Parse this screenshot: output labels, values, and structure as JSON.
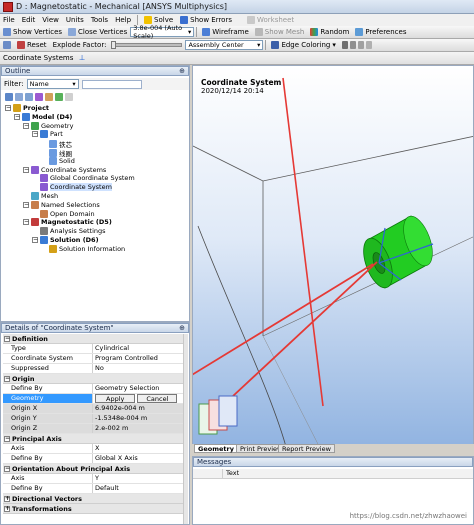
{
  "window": {
    "title": "D : Magnetostatic - Mechanical [ANSYS Multiphysics]"
  },
  "menubar": {
    "items": [
      "File",
      "Edit",
      "View",
      "Units",
      "Tools",
      "Help"
    ],
    "solve_label": "Solve",
    "show_errors_label": "Show Errors",
    "worksheet_label": "Worksheet"
  },
  "toolbar2": {
    "show_vertices_label": "Show Vertices",
    "close_vertices_label": "Close Vertices",
    "autoscale_value": "3.8e-004 (Auto Scale)",
    "wireframe_label": "Wireframe",
    "show_mesh_label": "Show Mesh",
    "random_label": "Random",
    "preferences_label": "Preferences"
  },
  "toolbar3": {
    "reset_label": "Reset",
    "explode_label": "Explode Factor:",
    "assembly_center_value": "Assembly Center",
    "edge_coloring_label": "Edge Coloring"
  },
  "context_toolbar": {
    "label": "Coordinate Systems"
  },
  "outline": {
    "title": "Outline",
    "pin": "⊕",
    "filter_label": "Filter:",
    "filter_value": "Name",
    "tree": [
      {
        "label": "Project",
        "level": 0,
        "bold": true
      },
      {
        "label": "Model (D4)",
        "level": 1,
        "bold": true
      },
      {
        "label": "Geometry",
        "level": 2
      },
      {
        "label": "Part",
        "level": 3
      },
      {
        "label": "铁芯",
        "level": 4
      },
      {
        "label": "线圈",
        "level": 4
      },
      {
        "label": "Solid",
        "level": 4
      },
      {
        "label": "Coordinate Systems",
        "level": 2
      },
      {
        "label": "Global Coordinate System",
        "level": 3
      },
      {
        "label": "Coordinate System",
        "level": 3
      },
      {
        "label": "Mesh",
        "level": 2
      },
      {
        "label": "Named Selections",
        "level": 2
      },
      {
        "label": "Open Domain",
        "level": 3
      },
      {
        "label": "Magnetostatic (D5)",
        "level": 2,
        "bold": true
      },
      {
        "label": "Analysis Settings",
        "level": 3
      },
      {
        "label": "Solution (D6)",
        "level": 3,
        "bold": true
      },
      {
        "label": "Solution Information",
        "level": 4
      }
    ]
  },
  "details": {
    "title": "Details of \"Coordinate System\"",
    "pin": "⊕",
    "sections": [
      {
        "name": "Definition",
        "rows": [
          {
            "key": "Type",
            "value": "Cylindrical"
          },
          {
            "key": "Coordinate System",
            "value": "Program Controlled"
          },
          {
            "key": "Suppressed",
            "value": "No"
          }
        ]
      },
      {
        "name": "Origin",
        "rows": [
          {
            "key": "Define By",
            "value": "Geometry Selection"
          },
          {
            "key": "Geometry",
            "value": ""
          },
          {
            "key": "Origin X",
            "value": "6.9402e-004 m"
          },
          {
            "key": "Origin Y",
            "value": "-1.5348e-004 m"
          },
          {
            "key": "Origin Z",
            "value": "2.e-002 m"
          }
        ]
      },
      {
        "name": "Principal Axis",
        "rows": [
          {
            "key": "Axis",
            "value": "X"
          },
          {
            "key": "Define By",
            "value": "Global X Axis"
          }
        ]
      },
      {
        "name": "Orientation About Principal Axis",
        "rows": [
          {
            "key": "Axis",
            "value": "Y"
          },
          {
            "key": "Define By",
            "value": "Default"
          }
        ]
      },
      {
        "name": "Directional Vectors",
        "rows": []
      },
      {
        "name": "Transformations",
        "rows": []
      }
    ],
    "apply_label": "Apply",
    "cancel_label": "Cancel"
  },
  "viewport": {
    "title": "Coordinate System",
    "date": "2020/12/14 20:14"
  },
  "bottom_tabs": [
    "Geometry",
    "Print Preview",
    "Report Preview"
  ],
  "messages": {
    "title": "Messages",
    "col_text": "Text"
  },
  "watermark": "https://blog.csdn.net/zhwzhaowei",
  "colors": {
    "accent": "#3399ff",
    "part_green": "#22cc22",
    "arrow_red": "#e53935",
    "viewport_top": "#ffffff",
    "viewport_bottom": "#8fb2e0"
  }
}
